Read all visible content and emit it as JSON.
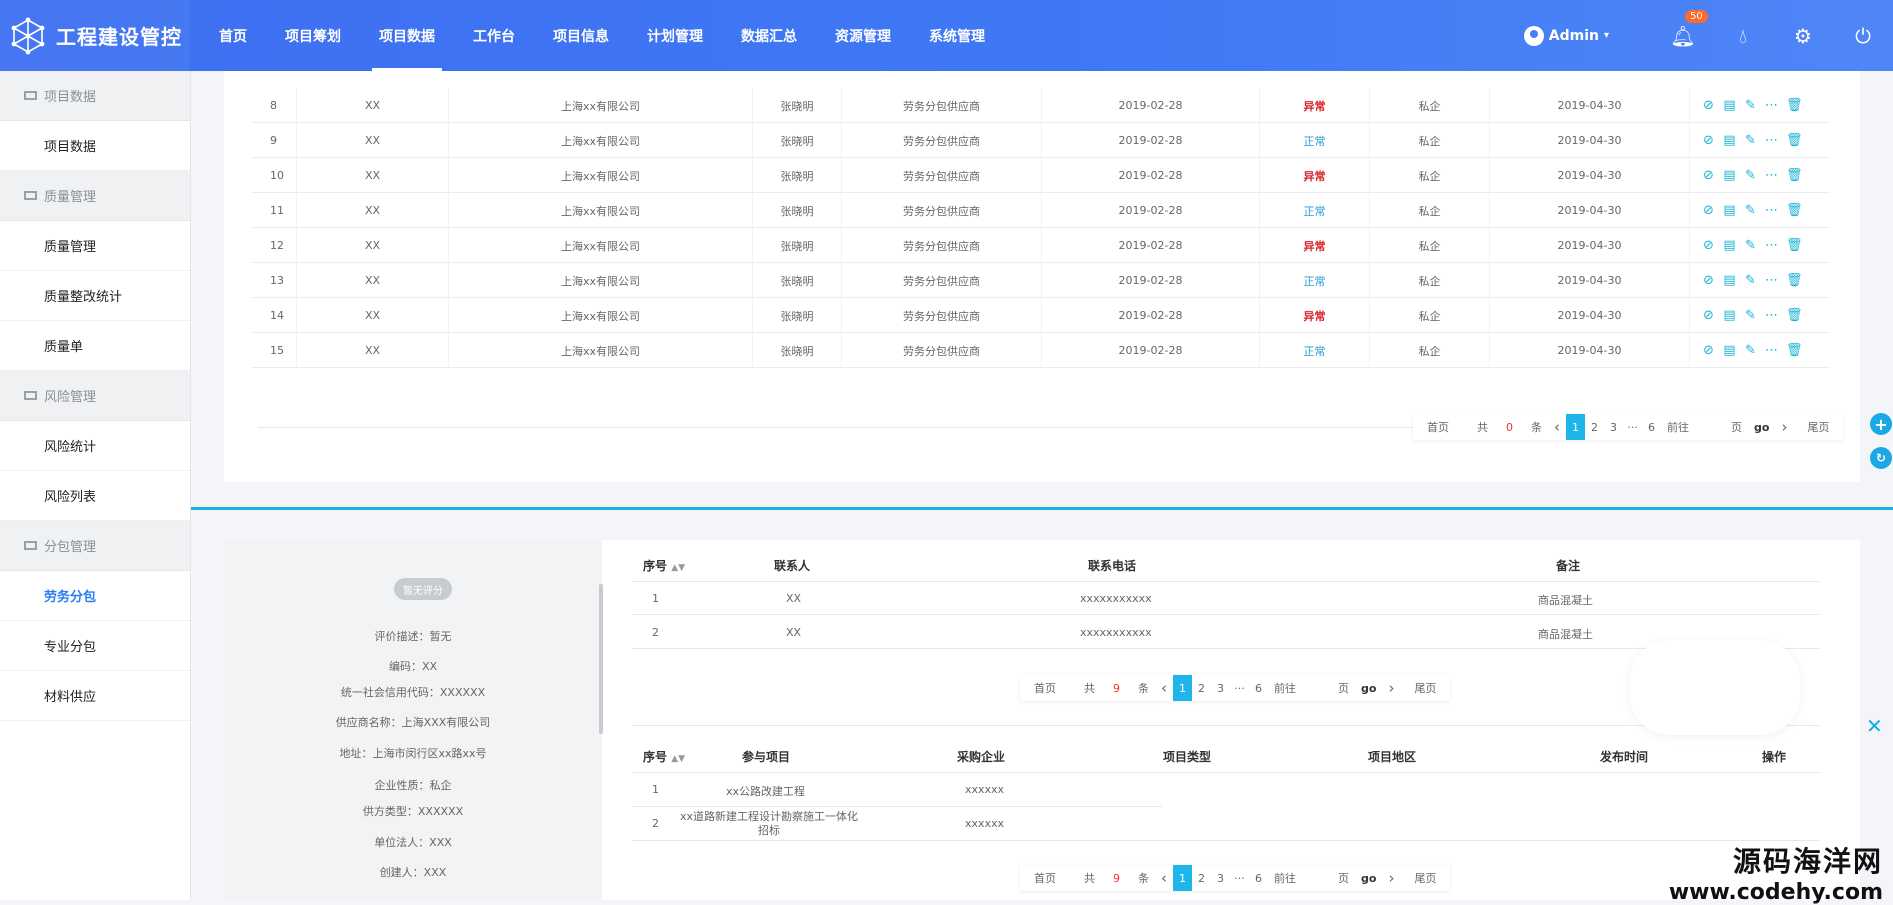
{
  "app": {
    "title": "工程建设管控"
  },
  "nav": [
    "首页",
    "项目筹划",
    "项目数据",
    "工作台",
    "项目信息",
    "计划管理",
    "数据汇总",
    "资源管理",
    "系统管理"
  ],
  "header": {
    "user": "Admin",
    "notifications": "50"
  },
  "sidebar": [
    {
      "group": "项目数据",
      "items": [
        "项目数据"
      ]
    },
    {
      "group": "质量管理",
      "items": [
        "质量管理",
        "质量整改统计",
        "质量单"
      ]
    },
    {
      "group": "风险管理",
      "items": [
        "风险统计",
        "风险列表"
      ]
    },
    {
      "group": "分包管理",
      "items": [
        "劳务分包",
        "专业分包",
        "材料供应"
      ]
    }
  ],
  "top_table": {
    "rows": [
      {
        "idx": "8",
        "code": "XX",
        "company": "上海xx有限公司",
        "person": "张晓明",
        "type": "劳务分包供应商",
        "date1": "2019-02-28",
        "status": "异常",
        "nature": "私企",
        "date2": "2019-04-30"
      },
      {
        "idx": "9",
        "code": "XX",
        "company": "上海xx有限公司",
        "person": "张晓明",
        "type": "劳务分包供应商",
        "date1": "2019-02-28",
        "status": "正常",
        "nature": "私企",
        "date2": "2019-04-30"
      },
      {
        "idx": "10",
        "code": "XX",
        "company": "上海xx有限公司",
        "person": "张晓明",
        "type": "劳务分包供应商",
        "date1": "2019-02-28",
        "status": "异常",
        "nature": "私企",
        "date2": "2019-04-30"
      },
      {
        "idx": "11",
        "code": "XX",
        "company": "上海xx有限公司",
        "person": "张晓明",
        "type": "劳务分包供应商",
        "date1": "2019-02-28",
        "status": "正常",
        "nature": "私企",
        "date2": "2019-04-30"
      },
      {
        "idx": "12",
        "code": "XX",
        "company": "上海xx有限公司",
        "person": "张晓明",
        "type": "劳务分包供应商",
        "date1": "2019-02-28",
        "status": "异常",
        "nature": "私企",
        "date2": "2019-04-30"
      },
      {
        "idx": "13",
        "code": "XX",
        "company": "上海xx有限公司",
        "person": "张晓明",
        "type": "劳务分包供应商",
        "date1": "2019-02-28",
        "status": "正常",
        "nature": "私企",
        "date2": "2019-04-30"
      },
      {
        "idx": "14",
        "code": "XX",
        "company": "上海xx有限公司",
        "person": "张晓明",
        "type": "劳务分包供应商",
        "date1": "2019-02-28",
        "status": "异常",
        "nature": "私企",
        "date2": "2019-04-30"
      },
      {
        "idx": "15",
        "code": "XX",
        "company": "上海xx有限公司",
        "person": "张晓明",
        "type": "劳务分包供应商",
        "date1": "2019-02-28",
        "status": "正常",
        "nature": "私企",
        "date2": "2019-04-30"
      }
    ],
    "pager": {
      "first": "首页",
      "total_prefix": "共",
      "total": "0",
      "total_suffix": "条",
      "pages": [
        "1",
        "2",
        "3",
        "···",
        "6"
      ],
      "goto": "前往",
      "page_unit": "页",
      "go": "go",
      "last": "尾页"
    }
  },
  "profile": {
    "no_score": "暂无评分",
    "lines": [
      "评价描述：暂无",
      "编码：XX",
      "统一社会信用代码：XXXXXX",
      "供应商名称：上海XXX有限公司",
      "地址：上海市闵行区xx路xx号",
      "企业性质：私企",
      "供方类型：XXXXXX",
      "单位法人：XXX",
      "创建人：XXX"
    ]
  },
  "contacts_table": {
    "headers": [
      "序号",
      "联系人",
      "联系电话",
      "备注"
    ],
    "rows": [
      [
        "1",
        "XX",
        "xxxxxxxxxxx",
        "商品混凝土"
      ],
      [
        "2",
        "XX",
        "xxxxxxxxxxx",
        "商品混凝土"
      ]
    ],
    "pager": {
      "first": "首页",
      "total_prefix": "共",
      "total": "9",
      "total_suffix": "条",
      "pages": [
        "1",
        "2",
        "3",
        "···",
        "6"
      ],
      "goto": "前往",
      "page_unit": "页",
      "go": "go",
      "last": "尾页"
    }
  },
  "projects_table": {
    "headers": [
      "序号",
      "参与项目",
      "采购企业",
      "项目类型",
      "项目地区",
      "发布时间",
      "操作"
    ],
    "rows": [
      [
        "1",
        "xx公路改建工程",
        "xxxxxx"
      ],
      [
        "2",
        "xx道路新建工程设计勘察施工一体化招标",
        "xxxxxx"
      ]
    ],
    "pager": {
      "first": "首页",
      "total_prefix": "共",
      "total": "9",
      "total_suffix": "条",
      "pages": [
        "1",
        "2",
        "3",
        "···",
        "6"
      ],
      "goto": "前往",
      "page_unit": "页",
      "go": "go",
      "last": "尾页"
    }
  },
  "watermark": {
    "line1": "源码海洋网",
    "line2": "www.codehy.com"
  },
  "colors": {
    "topbar": "#3f79f5",
    "accent": "#1ab0e6",
    "status_ok": "#1e9ed6",
    "status_bad": "#d9262c"
  }
}
